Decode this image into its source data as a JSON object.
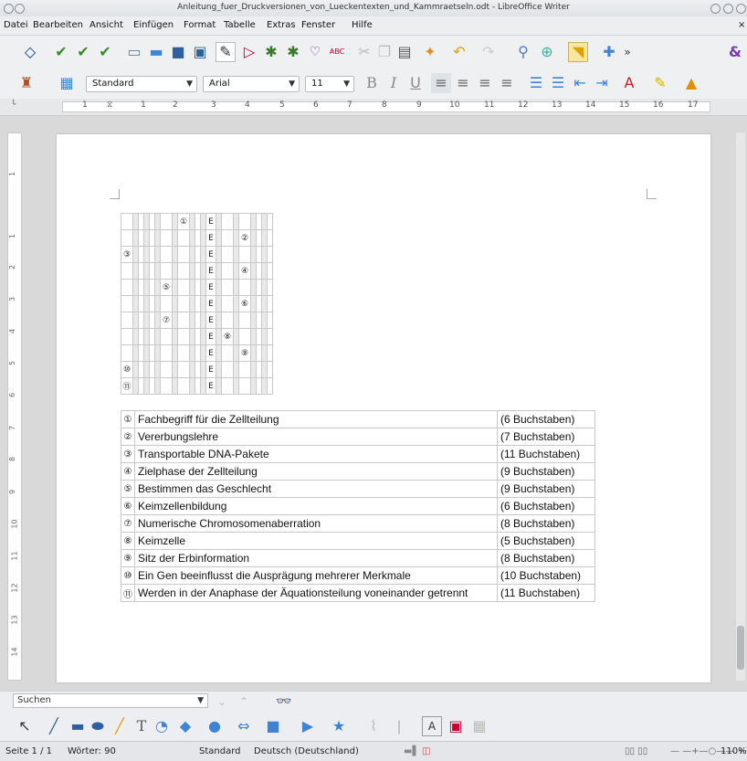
{
  "window": {
    "title": "Anleitung_fuer_Druckversionen_von_Lueckentexten_und_Kammraetseln.odt - LibreOffice Writer"
  },
  "menu": [
    "Datei",
    "Bearbeiten",
    "Ansicht",
    "Einfügen",
    "Format",
    "Tabelle",
    "Extras",
    "Fenster",
    "Hilfe"
  ],
  "formatting": {
    "style": "Standard",
    "font": "Arial",
    "size": "11"
  },
  "ruler": {
    "labels": [
      "1",
      "1",
      "2",
      "3",
      "4",
      "5",
      "6",
      "7",
      "8",
      "9",
      "10",
      "11",
      "12",
      "13",
      "14",
      "15",
      "16",
      "17",
      "18"
    ],
    "vlabels": [
      "1",
      "1",
      "2",
      "3",
      "4",
      "5",
      "6",
      "7",
      "8",
      "9",
      "10",
      "11",
      "12",
      "13",
      "14"
    ]
  },
  "puzzle": {
    "rows": [
      {
        "num": "",
        "marker": "①",
        "marker_col": 3
      },
      {
        "num": "",
        "marker": "②",
        "marker_col": 6
      },
      {
        "num": "③",
        "marker": "",
        "marker_col": -1
      },
      {
        "num": "",
        "marker": "④",
        "marker_col": 6
      },
      {
        "num": "",
        "marker": "⑤",
        "marker_col": 2
      },
      {
        "num": "",
        "marker": "⑥",
        "marker_col": 6
      },
      {
        "num": "",
        "marker": "⑦",
        "marker_col": 2
      },
      {
        "num": "",
        "marker": "⑧",
        "marker_col": 5
      },
      {
        "num": "",
        "marker": "⑨",
        "marker_col": 6
      },
      {
        "num": "⑩",
        "marker": "",
        "marker_col": -1
      },
      {
        "num": "⑪",
        "marker": "",
        "marker_col": -1
      }
    ],
    "solution_letter": "E",
    "clues": [
      {
        "num": "①",
        "text": "Fachbegriff für die Zellteilung",
        "letters": "(6 Buchstaben)"
      },
      {
        "num": "②",
        "text": "Vererbungslehre",
        "letters": "(7 Buchstaben)"
      },
      {
        "num": "③",
        "text": "Transportable DNA-Pakete",
        "letters": "(11 Buchstaben)"
      },
      {
        "num": "④",
        "text": "Zielphase der Zellteilung",
        "letters": "(9 Buchstaben)"
      },
      {
        "num": "⑤",
        "text": "Bestimmen das Geschlecht",
        "letters": "(9 Buchstaben)"
      },
      {
        "num": "⑥",
        "text": "Keimzellenbildung",
        "letters": "(6 Buchstaben)"
      },
      {
        "num": "⑦",
        "text": "Numerische Chromosomenaberration",
        "letters": "(8 Buchstaben)"
      },
      {
        "num": "⑧",
        "text": "Keimzelle",
        "letters": "(5 Buchstaben)"
      },
      {
        "num": "⑨",
        "text": "Sitz der Erbinformation",
        "letters": "(8 Buchstaben)"
      },
      {
        "num": "⑩",
        "text": "Ein Gen beeinflusst die Ausprägung mehrerer Merkmale",
        "letters": "(10 Buchstaben)"
      },
      {
        "num": "⑪",
        "text": "Werden in der Anaphase der Äquationsteilung voneinander getrennt",
        "letters": "(11 Buchstaben)"
      }
    ]
  },
  "find": {
    "placeholder": "Suchen"
  },
  "status": {
    "page": "Seite 1 / 1",
    "words": "Wörter: 90",
    "style": "Standard",
    "language": "Deutsch (Deutschland)",
    "zoom": "110%"
  },
  "colors": {
    "accent": "#3c84d6",
    "grid_gray": "#e9e9e9"
  }
}
